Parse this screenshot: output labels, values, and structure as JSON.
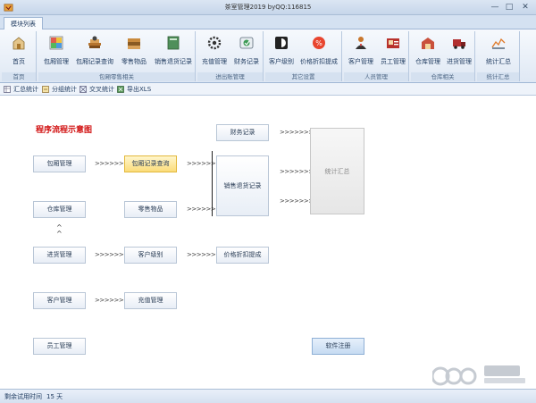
{
  "window": {
    "title": "茶室管理2019 byQQ:116815",
    "minimize": "—",
    "maximize": "□",
    "close": "✕"
  },
  "ribbon_tab": "模块列表",
  "ribbon": {
    "groups": [
      {
        "label": "首页",
        "buttons": [
          {
            "label": "首页",
            "icon": "home-icon"
          }
        ]
      },
      {
        "label": "包厢零售相关",
        "buttons": [
          {
            "label": "包厢管理",
            "icon": "room-icon"
          },
          {
            "label": "包厢记录查询",
            "icon": "books-icon"
          },
          {
            "label": "零售物品",
            "icon": "goods-icon"
          },
          {
            "label": "销售退货记录",
            "icon": "ledger-icon"
          }
        ]
      },
      {
        "label": "进出账管理",
        "buttons": [
          {
            "label": "充值管理",
            "icon": "gear-icon"
          },
          {
            "label": "财务记录",
            "icon": "finance-icon"
          }
        ]
      },
      {
        "label": "其它设置",
        "buttons": [
          {
            "label": "客户级别",
            "icon": "level-icon"
          },
          {
            "label": "价格折扣提成",
            "icon": "discount-icon"
          }
        ]
      },
      {
        "label": "人员管理",
        "buttons": [
          {
            "label": "客户管理",
            "icon": "customer-icon"
          },
          {
            "label": "员工管理",
            "icon": "staff-icon"
          }
        ]
      },
      {
        "label": "仓库相关",
        "buttons": [
          {
            "label": "仓库管理",
            "icon": "warehouse-icon"
          },
          {
            "label": "进货管理",
            "icon": "truck-icon"
          }
        ]
      },
      {
        "label": "统计汇总",
        "buttons": [
          {
            "label": "统计汇总",
            "icon": "chart-icon"
          }
        ]
      }
    ]
  },
  "subbar": {
    "items": [
      "汇总统计",
      "分组统计",
      "交叉统计",
      "导出XLS"
    ]
  },
  "diagram": {
    "title": "程序流程示意图",
    "nodes": {
      "room": "包厢管理",
      "warehouse": "仓库管理",
      "purchase": "进货管理",
      "customer": "客户管理",
      "staff": "员工管理",
      "room_query": "包厢记录查询",
      "retail": "零售物品",
      "level": "客户级别",
      "recharge": "充值管理",
      "finance": "财务记录",
      "sales_return": "销售退货记录",
      "discount": "价格折扣提成",
      "summary": "统计汇总",
      "register": "软件注册"
    },
    "arrow": ">>>>>>>",
    "up_arrow": "^"
  },
  "status": {
    "label": "剩余试用时间",
    "days": "15 天"
  },
  "watermark": "pc6 下载站",
  "colors": {
    "title_red": "#d10f0f",
    "highlight": "#fbdc7a",
    "register_blue": "#c6dbf2"
  }
}
